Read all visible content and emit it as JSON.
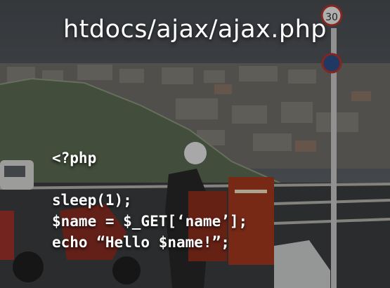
{
  "slide": {
    "title": "htdocs/ajax/ajax.php",
    "code_lines": [
      "<?php",
      "",
      "sleep(1);",
      "$name = $_GET[‘name’];",
      "echo “Hello $name!”;"
    ],
    "speed_sign": "30"
  },
  "colors": {
    "text": "#ffffff",
    "sky": "#5b6066",
    "hill": "#5c6b52"
  }
}
